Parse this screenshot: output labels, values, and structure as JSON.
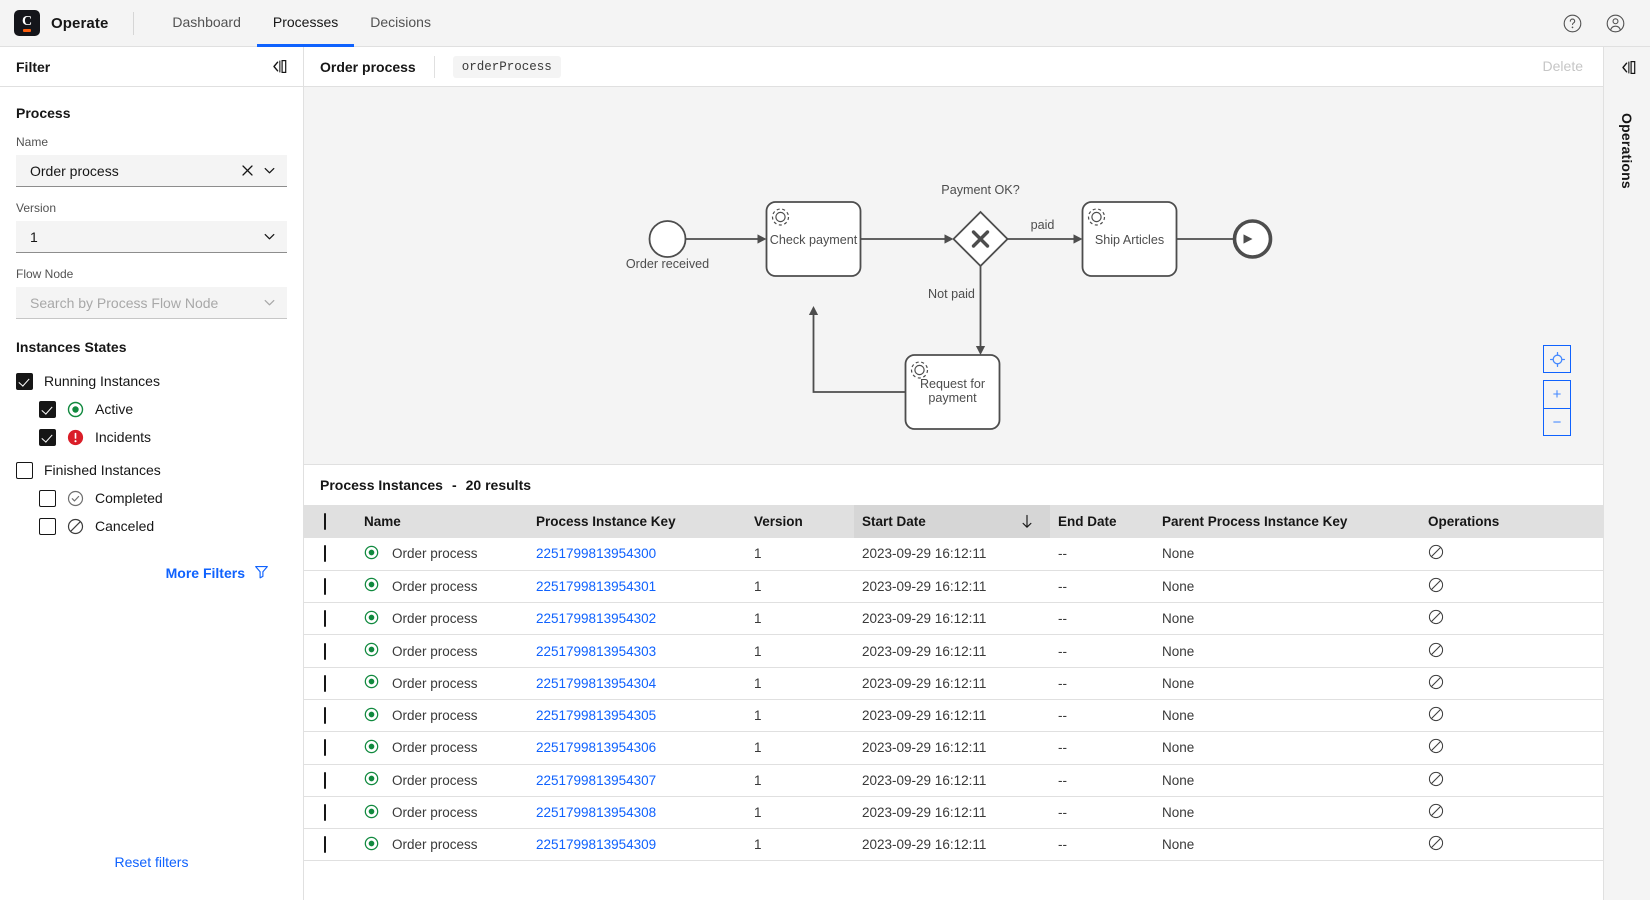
{
  "topbar": {
    "brand": "Operate",
    "logo_letter": "C",
    "nav": [
      {
        "label": "Dashboard",
        "active": false
      },
      {
        "label": "Processes",
        "active": true
      },
      {
        "label": "Decisions",
        "active": false
      }
    ],
    "help_icon": "help-icon",
    "user_icon": "user-avatar-icon"
  },
  "sidebar": {
    "title": "Filter",
    "collapse_icon": "panel-collapse-icon",
    "process_group": "Process",
    "name_label": "Name",
    "name_value": "Order process",
    "version_label": "Version",
    "version_value": "1",
    "flownode_label": "Flow Node",
    "flownode_placeholder": "Search by Process Flow Node",
    "states_title": "Instances States",
    "states": [
      {
        "label": "Running Instances",
        "checked": true,
        "indent": false,
        "icon": ""
      },
      {
        "label": "Active",
        "checked": true,
        "indent": true,
        "icon": "active-icon"
      },
      {
        "label": "Incidents",
        "checked": true,
        "indent": true,
        "icon": "incident-icon"
      },
      {
        "label": "Finished Instances",
        "checked": false,
        "indent": false,
        "icon": ""
      },
      {
        "label": "Completed",
        "checked": false,
        "indent": true,
        "icon": "completed-icon"
      },
      {
        "label": "Canceled",
        "checked": false,
        "indent": true,
        "icon": "canceled-icon"
      }
    ],
    "more_filters": "More Filters",
    "reset_filters": "Reset filters"
  },
  "main_header": {
    "title": "Order process",
    "process_id": "orderProcess",
    "delete_label": "Delete"
  },
  "diagram": {
    "start_event_label": "Order received",
    "task_check_payment": "Check payment",
    "gateway_label": "Payment OK?",
    "flow_paid": "paid",
    "flow_not_paid": "Not paid",
    "task_ship_articles": "Ship Articles",
    "task_request_payment": "Request for payment",
    "zoom_reset_icon": "fit-viewport-icon",
    "zoom_in_label": "+",
    "zoom_out_label": "−"
  },
  "table": {
    "title": "Process Instances",
    "separator": "-",
    "results_text": "20 results",
    "columns": [
      "Name",
      "Process Instance Key",
      "Version",
      "Start Date",
      "End Date",
      "Parent Process Instance Key",
      "Operations"
    ],
    "sorted_column": "Start Date",
    "sort_direction": "descending",
    "rows": [
      {
        "status": "active",
        "name": "Order process",
        "key": "2251799813954300",
        "version": "1",
        "start": "2023-09-29 16:12:11",
        "end": "--",
        "parent": "None",
        "op": "cancel-icon"
      },
      {
        "status": "active",
        "name": "Order process",
        "key": "2251799813954301",
        "version": "1",
        "start": "2023-09-29 16:12:11",
        "end": "--",
        "parent": "None",
        "op": "cancel-icon"
      },
      {
        "status": "active",
        "name": "Order process",
        "key": "2251799813954302",
        "version": "1",
        "start": "2023-09-29 16:12:11",
        "end": "--",
        "parent": "None",
        "op": "cancel-icon"
      },
      {
        "status": "active",
        "name": "Order process",
        "key": "2251799813954303",
        "version": "1",
        "start": "2023-09-29 16:12:11",
        "end": "--",
        "parent": "None",
        "op": "cancel-icon"
      },
      {
        "status": "active",
        "name": "Order process",
        "key": "2251799813954304",
        "version": "1",
        "start": "2023-09-29 16:12:11",
        "end": "--",
        "parent": "None",
        "op": "cancel-icon"
      },
      {
        "status": "active",
        "name": "Order process",
        "key": "2251799813954305",
        "version": "1",
        "start": "2023-09-29 16:12:11",
        "end": "--",
        "parent": "None",
        "op": "cancel-icon"
      },
      {
        "status": "active",
        "name": "Order process",
        "key": "2251799813954306",
        "version": "1",
        "start": "2023-09-29 16:12:11",
        "end": "--",
        "parent": "None",
        "op": "cancel-icon"
      },
      {
        "status": "active",
        "name": "Order process",
        "key": "2251799813954307",
        "version": "1",
        "start": "2023-09-29 16:12:11",
        "end": "--",
        "parent": "None",
        "op": "cancel-icon"
      },
      {
        "status": "active",
        "name": "Order process",
        "key": "2251799813954308",
        "version": "1",
        "start": "2023-09-29 16:12:11",
        "end": "--",
        "parent": "None",
        "op": "cancel-icon"
      },
      {
        "status": "active",
        "name": "Order process",
        "key": "2251799813954309",
        "version": "1",
        "start": "2023-09-29 16:12:11",
        "end": "--",
        "parent": "None",
        "op": "cancel-icon"
      }
    ]
  },
  "operations_panel": {
    "label": "Operations",
    "collapse_icon": "panel-collapse-icon"
  },
  "colors": {
    "accent": "#0f62fe",
    "active_green": "#10893e",
    "incident_red": "#da1e28",
    "brand_orange": "#fc5d0d",
    "header_bg": "#f4f4f4"
  }
}
